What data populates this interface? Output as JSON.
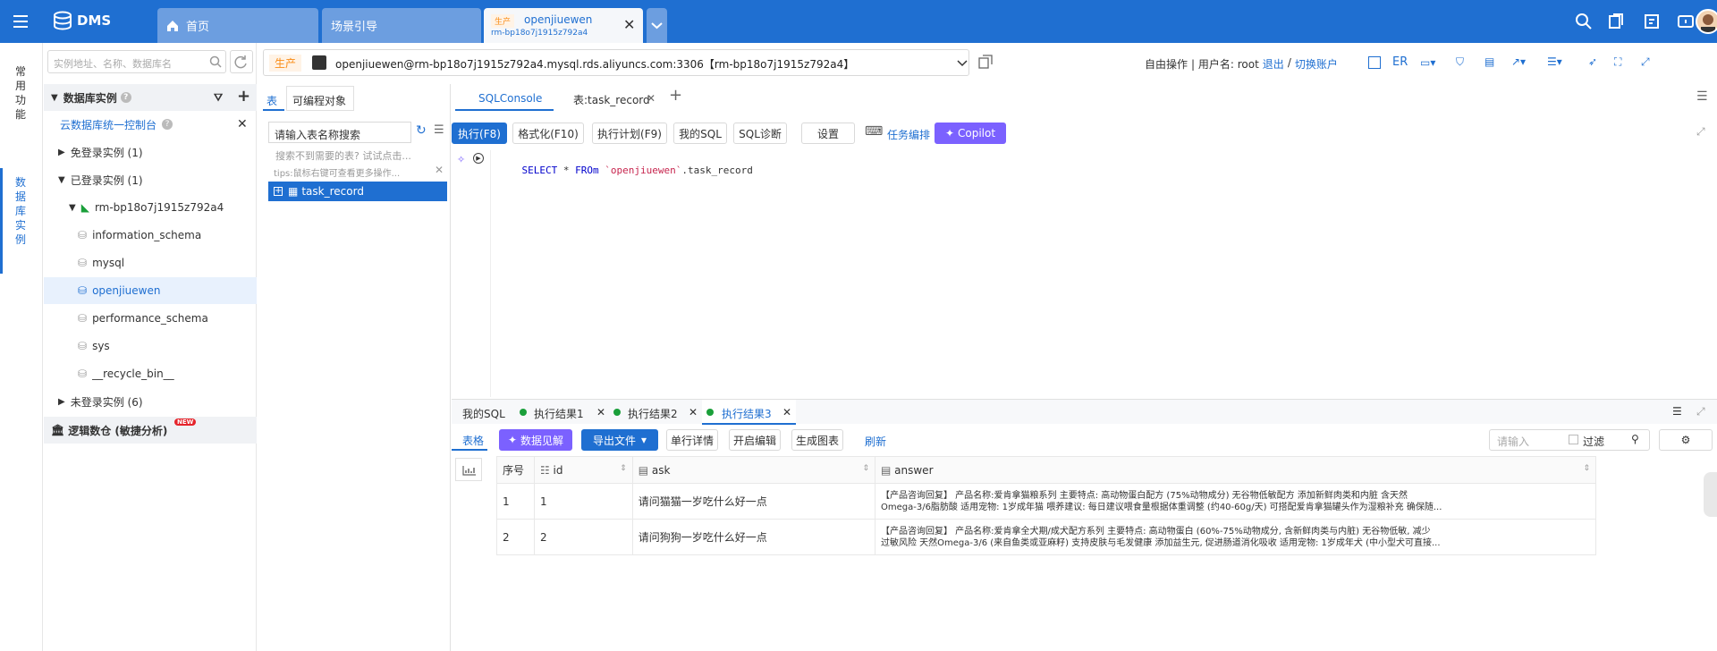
{
  "topbar": {
    "brand": "DMS",
    "tabs": [
      {
        "label": "首页"
      },
      {
        "label": "场景引导"
      },
      {
        "env": "生产",
        "title": "openjiuewen",
        "subtitle": "rm-bp18o7j1915z792a4"
      }
    ]
  },
  "rail": {
    "items": [
      {
        "label": "常用功能"
      },
      {
        "label": "数据库实例"
      }
    ]
  },
  "sidebar": {
    "search_placeholder": "实例地址、名称、数据库名",
    "section_title": "数据库实例",
    "console_link": "云数据库统一控制台",
    "groups": {
      "free": "免登录实例 (1)",
      "logged": "已登录实例 (1)",
      "not_logged": "未登录实例 (6)"
    },
    "instance": "rm-bp18o7j1915z792a4",
    "databases": [
      "information_schema",
      "mysql",
      "openjiuewen",
      "performance_schema",
      "sys",
      "__recycle_bin__"
    ],
    "logic_db": "逻辑数仓 (敏捷分析)",
    "new_badge": "NEW"
  },
  "env_bar": {
    "env_tag": "生产",
    "connection": "openjiuewen@rm-bp18o7j1915z792a4.mysql.rds.aliyuncs.com:3306【rm-bp18o7j1915z792a4】",
    "mode": "自由操作",
    "user_prefix": "| 用户名: root",
    "logout": "退出",
    "sep": "/",
    "switch_account": "切换账户",
    "er": "ER"
  },
  "midcol": {
    "tabs": [
      "表",
      "可编程对象"
    ],
    "search_value": "请输入表名称搜索",
    "hint1": "搜索不到需要的表? 试试点击...",
    "hint2": "tips:鼠标右键可查看更多操作...",
    "table_name": "task_record"
  },
  "editor": {
    "tabs": [
      "SQLConsole",
      "表:task_record"
    ],
    "toolbar": {
      "run": "执行(F8)",
      "format": "格式化(F10)",
      "plan": "执行计划(F9)",
      "my_sql": "我的SQL",
      "diagnose": "SQL诊断",
      "settings": "设置",
      "task_orch": "任务编排",
      "copilot": "Copilot"
    },
    "sql": {
      "kw1": "SELECT",
      "star": " * ",
      "kw2": "FROm",
      "space": " ",
      "schema": "`openjiuewen`",
      "rest": ".task_record"
    }
  },
  "result": {
    "tabs": [
      "我的SQL",
      "执行结果1",
      "执行结果2",
      "执行结果3"
    ],
    "toolbar": {
      "table": "表格",
      "insight": "数据见解",
      "export": "导出文件",
      "row_detail": "单行详情",
      "edit": "开启编辑",
      "chart": "生成图表",
      "refresh": "刷新",
      "filter_placeholder": "请输入",
      "filter": "过滤"
    },
    "columns": [
      "序号",
      "id",
      "ask",
      "answer"
    ],
    "rows": [
      {
        "no": "1",
        "id": "1",
        "ask": "请问猫猫一岁吃什么好一点",
        "answer1": "【产品咨询回复】 产品名称:爱肯拿猫粮系列 主要特点: 高动物蛋白配方 (75%动物成分) 无谷物低敏配方 添加新鲜肉类和内脏 含天然",
        "answer2": "Omega-3/6脂肪酸 适用宠物: 1岁成年猫 喂养建议: 每日建议喂食量根据体重调整 (约40-60g/天) 可搭配爱肯拿猫罐头作为湿粮补充 确保随..."
      },
      {
        "no": "2",
        "id": "2",
        "ask": "请问狗狗一岁吃什么好一点",
        "answer1": "【产品咨询回复】 产品名称:爱肯拿全犬期/成犬配方系列 主要特点: 高动物蛋白 (60%-75%动物成分, 含新鲜肉类与内脏) 无谷物低敏, 减少",
        "answer2": "过敏风险 天然Omega-3/6 (来自鱼类或亚麻籽) 支持皮肤与毛发健康 添加益生元, 促进肠道消化吸收 适用宠物: 1岁成年犬 (中小型犬可直接..."
      }
    ]
  },
  "colors": {
    "primary": "#1f6fd1",
    "env_tag": "#fa8c16",
    "purple": "#7b61ff",
    "green": "#1a9f3a"
  }
}
